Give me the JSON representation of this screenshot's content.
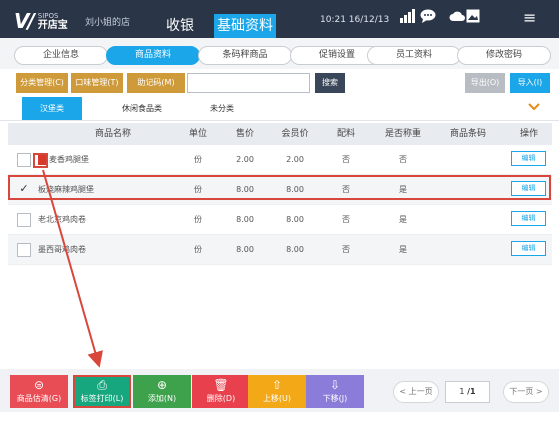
{
  "topbar": {
    "logo_small": "SIPOS",
    "logo_main": "开店宝",
    "shop_name": "刘小姐的店",
    "tabs": [
      "收银",
      "基础资料"
    ],
    "clock": "10:21  16/12/13",
    "icons": [
      "signal-icon",
      "chat-icon",
      "cloud-icon",
      "photo-icon",
      "menu-icon"
    ]
  },
  "subtabs": [
    "企业信息",
    "商品资料",
    "条码秤商品",
    "促销设置",
    "员工资料",
    "修改密码"
  ],
  "toolbar": {
    "category_mgmt": "分类管理(C)",
    "taste_mgmt": "口味管理(T)",
    "memo_code": "助记码(M)",
    "search_value": "",
    "search_label": "搜索",
    "export_label": "导出(O)",
    "import_label": "导入(I)"
  },
  "categories": [
    "汉堡类",
    "休闲食品类",
    "未分类"
  ],
  "table": {
    "headers": [
      "商品名称",
      "单位",
      "售价",
      "会员价",
      "配料",
      "是否称重",
      "商品条码",
      "操作"
    ],
    "rows": [
      {
        "name": "麦香鸡腿堡",
        "unit": "份",
        "price": "2.00",
        "member_price": "2.00",
        "ingredients": "否",
        "weighed": "否",
        "barcode": "",
        "action": "编辑",
        "checked": false
      },
      {
        "name": "板烧麻辣鸡腿堡",
        "unit": "份",
        "price": "8.00",
        "member_price": "8.00",
        "ingredients": "否",
        "weighed": "是",
        "barcode": "",
        "action": "编辑",
        "checked": true
      },
      {
        "name": "老北京鸡肉卷",
        "unit": "份",
        "price": "8.00",
        "member_price": "8.00",
        "ingredients": "否",
        "weighed": "是",
        "barcode": "",
        "action": "编辑",
        "checked": false
      },
      {
        "name": "墨西哥鸡肉卷",
        "unit": "份",
        "price": "8.00",
        "member_price": "8.00",
        "ingredients": "否",
        "weighed": "是",
        "barcode": "",
        "action": "编辑",
        "checked": false
      }
    ]
  },
  "bottom": {
    "buttons": [
      "商品估清(G)",
      "标签打印(L)",
      "添加(N)",
      "删除(D)",
      "上移(U)",
      "下移(J)"
    ],
    "prev_page": "< 上一页",
    "next_page": "下一页 >",
    "current_page": "1",
    "total_pages": "/1"
  },
  "colors": {
    "topbar": "#2a3547",
    "accent": "#1aa6e8",
    "highlight": "#d9463b",
    "toolbar_gold": "#cf9a3a"
  }
}
